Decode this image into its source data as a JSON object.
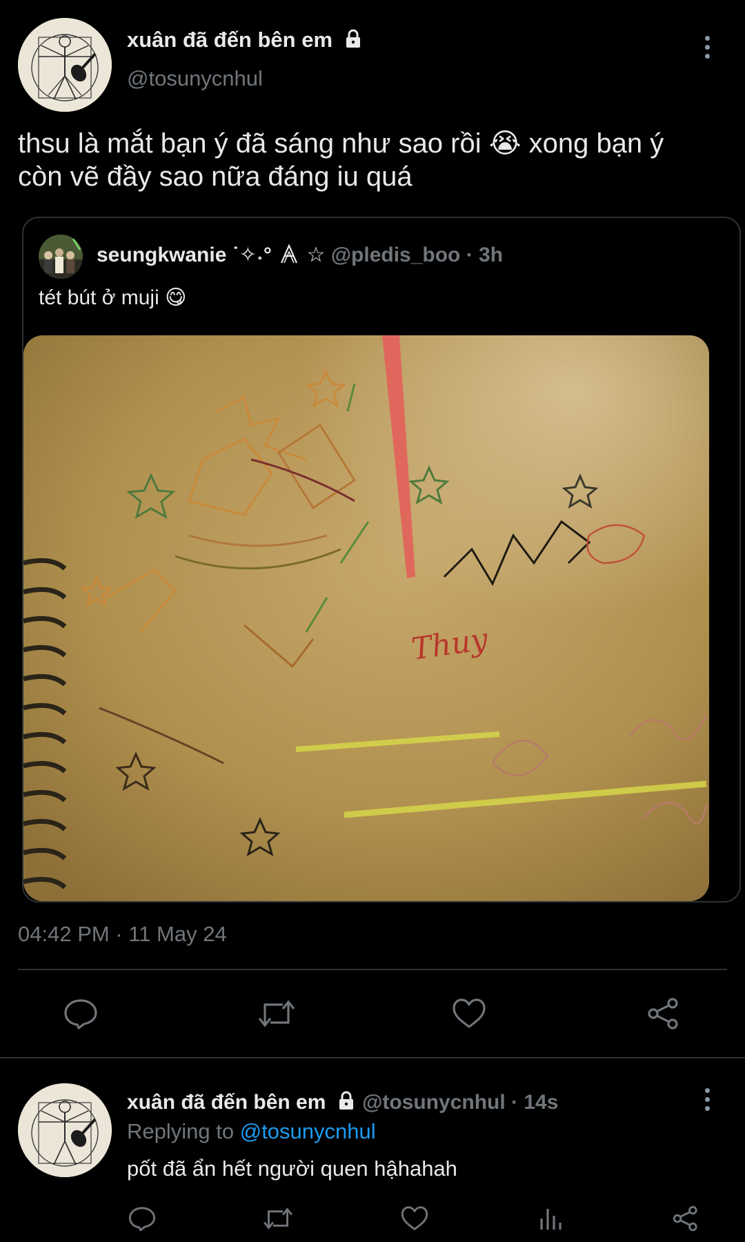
{
  "tweet": {
    "author_name": "xuân đã đến bên em",
    "author_handle": "@tosunycnhul",
    "text_line1": "thsu là mắt bạn ý đã sáng như sao rồi 😭 xong bạn ý",
    "text_line2": "còn vẽ đầy sao nữa đáng iu quá",
    "timestamp": "04:42 PM · 11 May 24"
  },
  "quote": {
    "author_name": "seungkwanie ˙✧˖°",
    "author_name_suffix": "☆",
    "meta": "@pledis_boo · 3h",
    "text": "tét bút ở muji 😋"
  },
  "photo": {
    "signature": "Thuy"
  },
  "reply": {
    "author_name": "xuân đã đến bên em",
    "meta": "@tosunycnhul · 14s",
    "replying_prefix": "Replying to",
    "replying_handle": "@tosunycnhul",
    "text": "pốt đã ẩn hết người quen hậhahah"
  },
  "colors": {
    "background": "#000000",
    "text_primary": "#e7e9ea",
    "text_secondary": "#71767b",
    "accent_link": "#1d9bf0",
    "divider": "#2f3336"
  },
  "icons": {
    "main_actions": [
      "reply-icon",
      "retweet-icon",
      "like-icon",
      "share-icon"
    ],
    "reply_actions": [
      "reply-icon",
      "retweet-icon",
      "like-icon",
      "analytics-icon",
      "share-icon"
    ]
  }
}
